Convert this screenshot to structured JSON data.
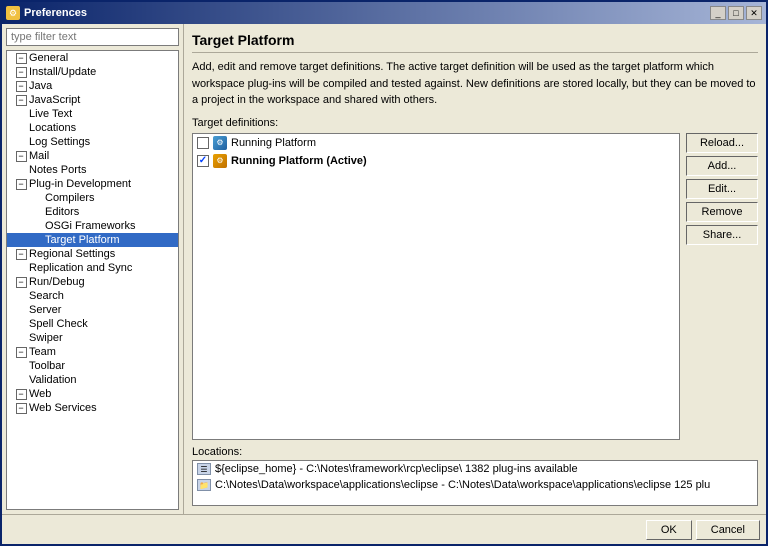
{
  "window": {
    "title": "Preferences",
    "icon": "⚙"
  },
  "filter": {
    "placeholder": "type filter text"
  },
  "tree": {
    "items": [
      {
        "id": "general",
        "label": "General",
        "indent": 0,
        "expanded": true,
        "has_children": true
      },
      {
        "id": "install-update",
        "label": "Install/Update",
        "indent": 0,
        "expanded": true,
        "has_children": true
      },
      {
        "id": "java",
        "label": "Java",
        "indent": 0,
        "expanded": true,
        "has_children": true
      },
      {
        "id": "javascript",
        "label": "JavaScript",
        "indent": 0,
        "expanded": true,
        "has_children": true
      },
      {
        "id": "live-text",
        "label": "Live Text",
        "indent": 0,
        "expanded": false,
        "has_children": false
      },
      {
        "id": "locations",
        "label": "Locations",
        "indent": 0,
        "expanded": false,
        "has_children": false
      },
      {
        "id": "log-settings",
        "label": "Log Settings",
        "indent": 0,
        "expanded": false,
        "has_children": false
      },
      {
        "id": "mail",
        "label": "Mail",
        "indent": 0,
        "expanded": true,
        "has_children": true
      },
      {
        "id": "notes-ports",
        "label": "Notes Ports",
        "indent": 0,
        "expanded": false,
        "has_children": false
      },
      {
        "id": "plug-in-dev",
        "label": "Plug-in Development",
        "indent": 0,
        "expanded": true,
        "has_children": true
      },
      {
        "id": "compilers",
        "label": "Compilers",
        "indent": 1,
        "expanded": false,
        "has_children": false
      },
      {
        "id": "editors",
        "label": "Editors",
        "indent": 1,
        "expanded": false,
        "has_children": false
      },
      {
        "id": "osgi-frameworks",
        "label": "OSGi Frameworks",
        "indent": 1,
        "expanded": false,
        "has_children": false
      },
      {
        "id": "target-platform",
        "label": "Target Platform",
        "indent": 1,
        "expanded": false,
        "has_children": false,
        "selected": true
      },
      {
        "id": "regional-settings",
        "label": "Regional Settings",
        "indent": 0,
        "expanded": true,
        "has_children": true
      },
      {
        "id": "replication-sync",
        "label": "Replication and Sync",
        "indent": 0,
        "expanded": false,
        "has_children": false
      },
      {
        "id": "run-debug",
        "label": "Run/Debug",
        "indent": 0,
        "expanded": true,
        "has_children": true
      },
      {
        "id": "search",
        "label": "Search",
        "indent": 0,
        "expanded": false,
        "has_children": false
      },
      {
        "id": "server",
        "label": "Server",
        "indent": 0,
        "expanded": false,
        "has_children": false
      },
      {
        "id": "spell-check",
        "label": "Spell Check",
        "indent": 0,
        "expanded": false,
        "has_children": false
      },
      {
        "id": "swiper",
        "label": "Swiper",
        "indent": 0,
        "expanded": false,
        "has_children": false
      },
      {
        "id": "team",
        "label": "Team",
        "indent": 0,
        "expanded": true,
        "has_children": true
      },
      {
        "id": "toolbar",
        "label": "Toolbar",
        "indent": 0,
        "expanded": false,
        "has_children": false
      },
      {
        "id": "validation",
        "label": "Validation",
        "indent": 0,
        "expanded": false,
        "has_children": false
      },
      {
        "id": "web",
        "label": "Web",
        "indent": 0,
        "expanded": true,
        "has_children": true
      },
      {
        "id": "web-services",
        "label": "Web Services",
        "indent": 0,
        "expanded": true,
        "has_children": true
      }
    ]
  },
  "main": {
    "title": "Target Platform",
    "description": "Add, edit and remove target definitions.  The active target definition will be used as the target platform which workspace plug-ins will be compiled and tested against.  New definitions are stored locally, but they can be moved to a project in the workspace and shared with others.",
    "target_defs_label": "Target definitions:",
    "list_items": [
      {
        "id": "running-platform",
        "label": "Running Platform",
        "checked": false,
        "active": false
      },
      {
        "id": "running-platform-active",
        "label": "Running Platform (Active)",
        "checked": true,
        "active": true
      }
    ],
    "buttons": {
      "reload": "Reload...",
      "add": "Add...",
      "edit": "Edit...",
      "remove": "Remove",
      "share": "Share..."
    },
    "locations_label": "Locations:",
    "locations": [
      {
        "text": "${eclipse_home} - C:\\Notes\\framework\\rcp\\eclipse\\ 1382 plug-ins available"
      },
      {
        "text": "C:\\Notes\\Data\\workspace\\applications\\eclipse - C:\\Notes\\Data\\workspace\\applications\\eclipse 125 plu"
      }
    ]
  },
  "footer": {
    "ok": "OK",
    "cancel": "Cancel"
  }
}
